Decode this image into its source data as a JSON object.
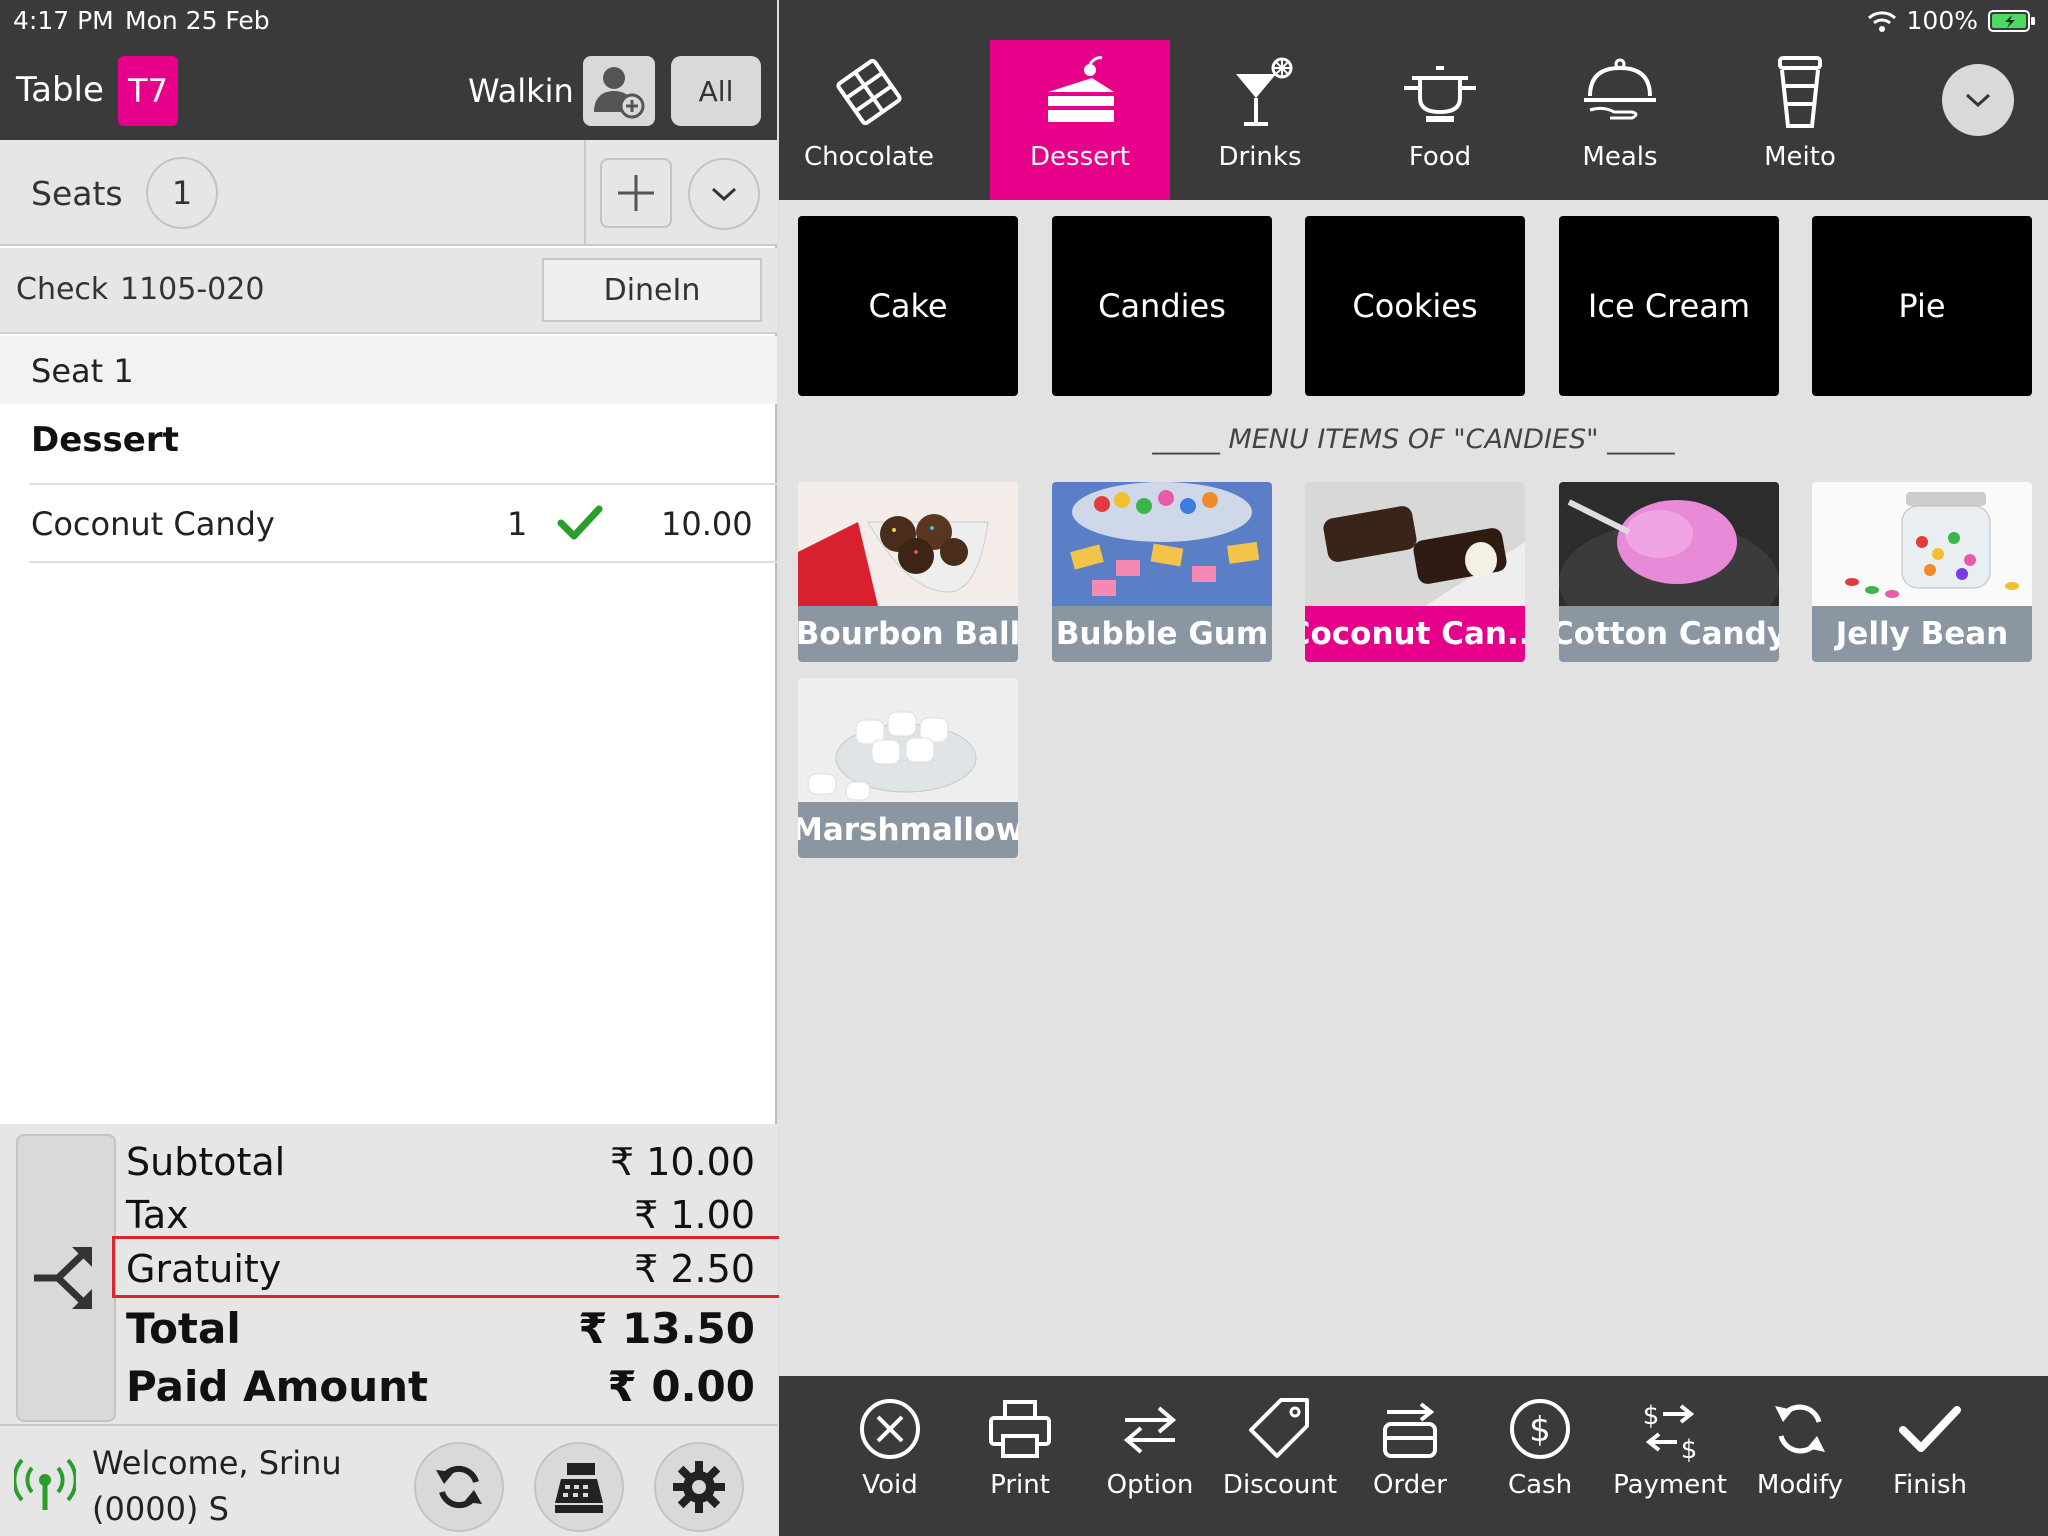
{
  "status": {
    "time": "4:17 PM",
    "date": "Mon 25 Feb",
    "battery": "100%"
  },
  "table": {
    "label": "Table",
    "badge": "T7"
  },
  "customer": {
    "label": "Walkin",
    "all_label": "All"
  },
  "seats": {
    "label": "Seats",
    "count": "1"
  },
  "check": {
    "label": "Check",
    "number": "1105-020",
    "type": "DineIn"
  },
  "order": {
    "seat_header": "Seat 1",
    "category": "Dessert",
    "items": [
      {
        "name": "Coconut Candy",
        "qty": "1",
        "price": "10.00"
      }
    ]
  },
  "totals": {
    "subtotal_label": "Subtotal",
    "subtotal": "₹ 10.00",
    "tax_label": "Tax",
    "tax": "₹ 1.00",
    "gratuity_label": "Gratuity",
    "gratuity": "₹ 2.50",
    "total_label": "Total",
    "total": "₹ 13.50",
    "paid_label": "Paid Amount",
    "paid": "₹ 0.00"
  },
  "footer": {
    "welcome_line1": "Welcome, Srinu",
    "welcome_line2": "(0000) S"
  },
  "categories": [
    {
      "label": "Chocolate",
      "icon": "chocolate-icon"
    },
    {
      "label": "Dessert",
      "icon": "cake-slice-icon",
      "active": true
    },
    {
      "label": "Drinks",
      "icon": "cocktail-icon"
    },
    {
      "label": "Food",
      "icon": "cooking-pot-icon"
    },
    {
      "label": "Meals",
      "icon": "cloche-icon"
    },
    {
      "label": "Meito",
      "icon": "cup-icon"
    }
  ],
  "subcategories": [
    "Cake",
    "Candies",
    "Cookies",
    "Ice Cream",
    "Pie"
  ],
  "menu_caption": "_____ MENU ITEMS OF \"CANDIES\" _____",
  "menu_items": [
    {
      "label": "Bourbon Ball"
    },
    {
      "label": "Bubble Gum"
    },
    {
      "label": "Coconut Can...",
      "selected": true
    },
    {
      "label": "Cotton Candy"
    },
    {
      "label": "Jelly Bean"
    },
    {
      "label": "Marshmallow"
    }
  ],
  "actions": [
    "Void",
    "Print",
    "Option",
    "Discount",
    "Order",
    "Cash",
    "Payment",
    "Modify",
    "Finish"
  ],
  "colors": {
    "accent": "#e6008a",
    "dark_bar": "#3a3a3a",
    "highlight_box": "#d9262c",
    "check_green": "#2a9d2a"
  }
}
